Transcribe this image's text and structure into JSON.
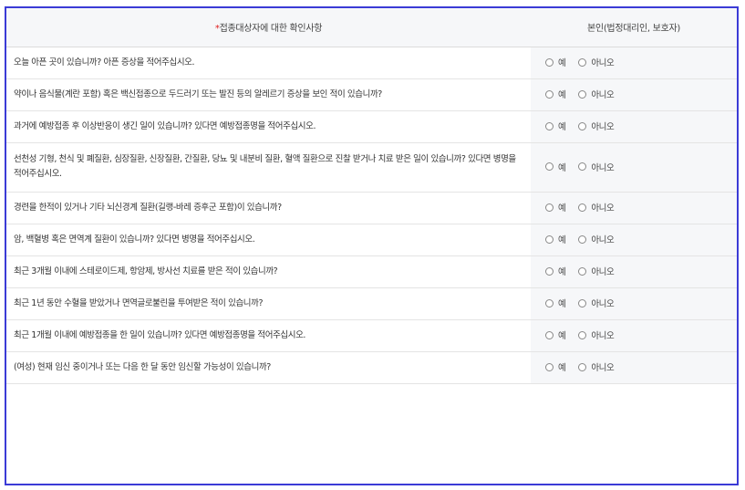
{
  "header": {
    "required_mark": "*",
    "question_column": "접종대상자에 대한 확인사항",
    "answer_column": "본인(법정대리인, 보호자)"
  },
  "options": {
    "yes": "예",
    "no": "아니오"
  },
  "questions": [
    {
      "text": "오늘 아픈 곳이 있습니까? 아픈 증상을 적어주십시오."
    },
    {
      "text": "약이나 음식물(계란 포함) 혹은 백신접종으로 두드러기 또는 발진 등의 알레르기 증상을 보인 적이 있습니까?"
    },
    {
      "text": "과거에 예방접종 후 이상반응이 생긴 일이 있습니까? 있다면 예방접종명을 적어주십시오."
    },
    {
      "text": "선천성 기형, 천식 및 폐질환, 심장질환, 신장질환, 간질환, 당뇨 및 내분비 질환, 혈액 질환으로 진찰 받거나 치료 받은 일이 있습니까? 있다면 병명을 적어주십시오."
    },
    {
      "text": "경련을 한적이 있거나 기타 뇌신경계 질환(길랭-바레 증후군 포함)이 있습니까?"
    },
    {
      "text": "암, 백혈병 혹은 면역계 질환이 있습니까? 있다면 병명을 적어주십시오."
    },
    {
      "text": "최근 3개월 이내에 스테로이드제, 항암제, 방사선 치료를 받은 적이 있습니까?"
    },
    {
      "text": "최근 1년 동안 수혈을 받았거나 면역글로불린을 투여받은 적이 있습니까?"
    },
    {
      "text": "최근 1개월 이내에 예방접종을 한 일이 있습니까? 있다면 예방접종명을 적어주십시오."
    },
    {
      "text": "(여성) 현재 임신 중이거나 또는 다음 한 달 동안 임신할 가능성이 있습니까?"
    }
  ],
  "colors": {
    "frame_border": "#3b3bd6",
    "required": "#e02020",
    "header_bg": "#f6f7f9"
  }
}
